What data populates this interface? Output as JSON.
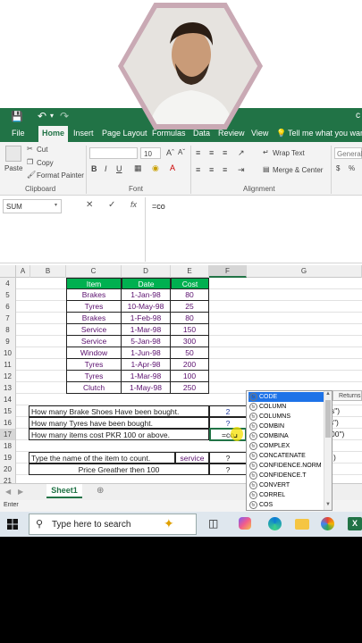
{
  "app": {
    "ribbon_tabs": [
      "File",
      "Home",
      "Insert",
      "Page Layout",
      "Formulas",
      "Data",
      "Review",
      "View"
    ],
    "tell_me": "Tell me what you want t",
    "clipboard": {
      "paste": "Paste",
      "cut": "Cut",
      "copy": "Copy",
      "format_painter": "Format Painter",
      "label": "Clipboard"
    },
    "font": {
      "size": "10",
      "label": "Font"
    },
    "alignment": {
      "wrap": "Wrap Text",
      "merge": "Merge & Center",
      "label": "Alignment"
    },
    "number": {
      "format": "General"
    },
    "name_box": "SUM",
    "formula": "=co",
    "fx_label": "fx"
  },
  "grid": {
    "columns": [
      "A",
      "B",
      "C",
      "D",
      "E",
      "F",
      "G"
    ],
    "rows": [
      "4",
      "5",
      "6",
      "7",
      "8",
      "9",
      "10",
      "11",
      "12",
      "13",
      "14",
      "15",
      "16",
      "17",
      "18",
      "19",
      "20",
      "21"
    ],
    "table_header": {
      "item": "Item",
      "date": "Date",
      "cost": "Cost"
    },
    "table_rows": [
      {
        "item": "Brakes",
        "date": "1-Jan-98",
        "cost": "80"
      },
      {
        "item": "Tyres",
        "date": "10-May-98",
        "cost": "25"
      },
      {
        "item": "Brakes",
        "date": "1-Feb-98",
        "cost": "80"
      },
      {
        "item": "Service",
        "date": "1-Mar-98",
        "cost": "150"
      },
      {
        "item": "Service",
        "date": "5-Jan-98",
        "cost": "300"
      },
      {
        "item": "Window",
        "date": "1-Jun-98",
        "cost": "50"
      },
      {
        "item": "Tyres",
        "date": "1-Apr-98",
        "cost": "200"
      },
      {
        "item": "Tyres",
        "date": "1-Mar-98",
        "cost": "100"
      },
      {
        "item": "Clutch",
        "date": "1-May-98",
        "cost": "250"
      }
    ],
    "q1": "How many Brake Shoes Have been bought.",
    "q1_ans": "2",
    "q2": "How many Tyres have been bought.",
    "q2_ans": "?",
    "q3": "How many items cost PKR 100 or above.",
    "q3_ans": "=co",
    "q4": "Type the name of the item to count.",
    "q4_val": "service",
    "q4_ans": "?",
    "q5": "Price Greather then 100",
    "q5_ans": "?",
    "g15": "kes\")",
    "g16": "es\")",
    "g17": "00\")",
    "g19": ")"
  },
  "autocomplete": {
    "items": [
      "CODE",
      "COLUMN",
      "COLUMNS",
      "COMBIN",
      "COMBINA",
      "COMPLEX",
      "CONCATENATE",
      "CONFIDENCE.NORM",
      "CONFIDENCE.T",
      "CONVERT",
      "CORREL",
      "COS"
    ],
    "tooltip": "Returns"
  },
  "sheet_tab": "Sheet1",
  "status": "Enter",
  "taskbar": {
    "search_placeholder": "Type here to search"
  }
}
